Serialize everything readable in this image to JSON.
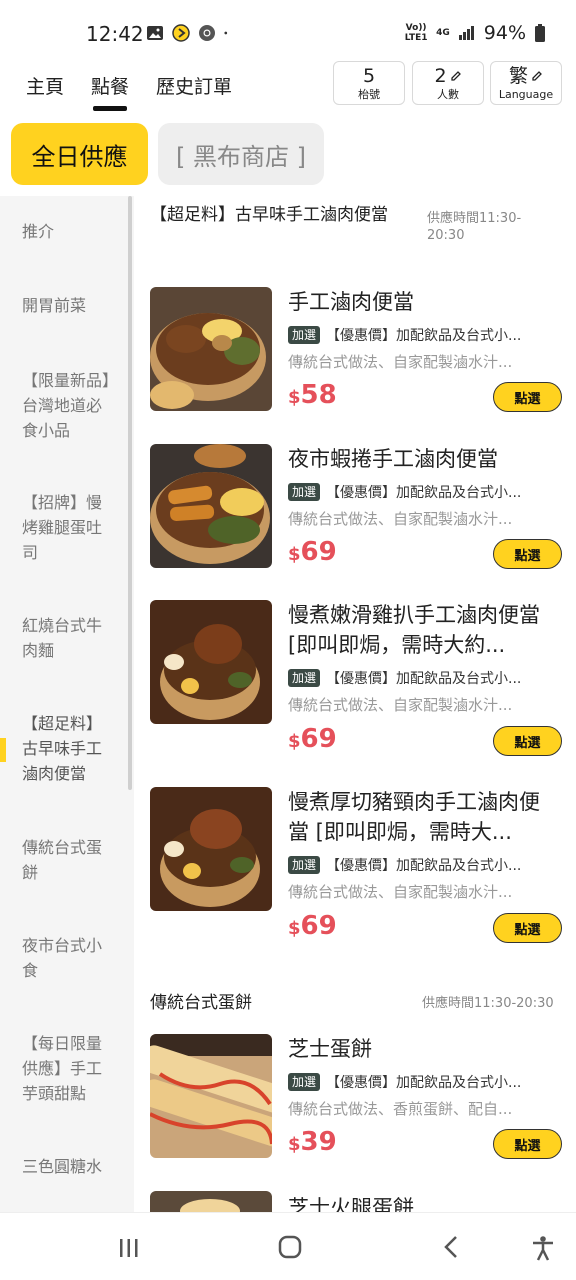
{
  "status": {
    "time": "12:42",
    "network": "4G",
    "volte": "Vo)) LTE1",
    "battery": "94%"
  },
  "nav": {
    "tabs": [
      "主頁",
      "點餐",
      "歷史訂單"
    ],
    "active_tab": "點餐",
    "table": {
      "value": "5",
      "label": "枱號"
    },
    "people": {
      "value": "2",
      "label": "人數"
    },
    "language": {
      "value": "繁",
      "label": "Language"
    }
  },
  "store_tabs": {
    "active": "全日供應",
    "inactive": "[ 黑布商店 ]"
  },
  "sidebar": {
    "items": [
      "推介",
      "開胃前菜",
      "【限量新品】台灣地道必食小品",
      "【招牌】慢烤雞腿蛋吐司",
      "紅燒台式牛肉麵",
      "【超足料】古早味手工滷肉便當",
      "傳統台式蛋餅",
      "夜市台式小食",
      "【每日限量供應】手工芋頭甜點",
      "三色圓糖水"
    ],
    "active_index": 5
  },
  "sections": [
    {
      "title": "【超足料】古早味手工滷肉便當",
      "hours": "供應時間11:30-20:30",
      "items": [
        {
          "name": "手工滷肉便當",
          "tag": "加選",
          "tag_text": "【優惠價】加配飲品及台式小...",
          "desc": "傳統台式做法、自家配製滷水汁...",
          "price": "58",
          "button": "點選"
        },
        {
          "name": "夜市蝦捲手工滷肉便當",
          "tag": "加選",
          "tag_text": "【優惠價】加配飲品及台式小...",
          "desc": "傳統台式做法、自家配製滷水汁...",
          "price": "69",
          "button": "點選"
        },
        {
          "name": "慢煮嫩滑雞扒手工滷肉便當 [即叫即焗，需時大約...",
          "tag": "加選",
          "tag_text": "【優惠價】加配飲品及台式小...",
          "desc": "傳統台式做法、自家配製滷水汁...",
          "price": "69",
          "button": "點選"
        },
        {
          "name": "慢煮厚切豬頸肉手工滷肉便當 [即叫即焗，需時大...",
          "tag": "加選",
          "tag_text": "【優惠價】加配飲品及台式小...",
          "desc": "傳統台式做法、自家配製滷水汁...",
          "price": "69",
          "button": "點選"
        }
      ]
    },
    {
      "title": "傳統台式蛋餅",
      "hours": "供應時間11:30-20:30",
      "items": [
        {
          "name": "芝士蛋餅",
          "tag": "加選",
          "tag_text": "【優惠價】加配飲品及台式小...",
          "desc": "傳統台式做法、香煎蛋餅、配自...",
          "price": "39",
          "button": "點選"
        },
        {
          "name": "芝士火腿蛋餅"
        }
      ]
    }
  ],
  "currency": "$",
  "colors": {
    "accent": "#ffd21f",
    "price": "#e5505a",
    "tag_bg": "#3b4a45"
  }
}
